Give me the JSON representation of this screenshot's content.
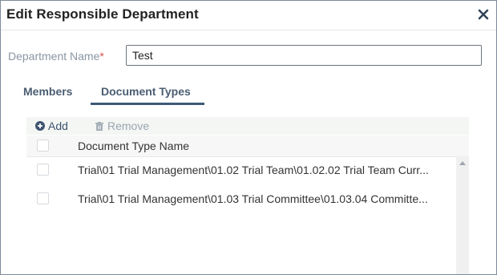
{
  "dialog": {
    "title": "Edit Responsible Department",
    "close_icon": "close-icon"
  },
  "form": {
    "department_label": "Department Name",
    "required_mark": "*",
    "department_value": "Test"
  },
  "tabs": [
    {
      "label": "Members",
      "active": false
    },
    {
      "label": "Document Types",
      "active": true
    }
  ],
  "toolbar": {
    "add_label": "Add",
    "add_icon": "plus-circle-icon",
    "remove_label": "Remove",
    "remove_icon": "trash-icon"
  },
  "grid": {
    "column_header": "Document Type Name",
    "rows": [
      {
        "name": "Trial\\01 Trial Management\\01.02 Trial Team\\01.02.02 Trial Team Curr..."
      },
      {
        "name": "Trial\\01 Trial Management\\01.03 Trial Committee\\01.03.04 Committe..."
      }
    ]
  },
  "colors": {
    "tab_text": "#4a5d72",
    "tab_underline": "#3d5a78",
    "required": "#d9534f"
  }
}
